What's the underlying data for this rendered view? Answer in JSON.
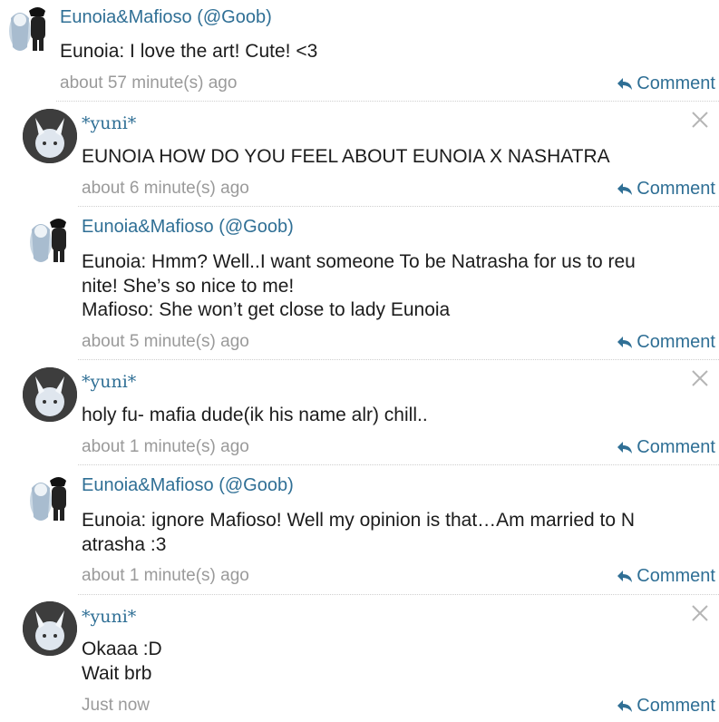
{
  "comments": [
    {
      "name": "Eunoia&Mafioso (@Goob)",
      "text": "Eunoia: I love the art! Cute! <3",
      "time": "about 57 minute(s) ago",
      "action": "Comment"
    },
    {
      "name": "*yuni*",
      "text": "EUNOIA HOW DO YOU FEEL ABOUT EUNOIA X NASHATRA",
      "time": "about 6 minute(s) ago",
      "action": "Comment"
    },
    {
      "name": "Eunoia&Mafioso (@Goob)",
      "text": "Eunoia: Hmm? Well..I want someone To be Natrasha for us to reu\nnite! She’s so nice to me!\nMafioso: She won’t get close to lady Eunoia",
      "time": "about 5 minute(s) ago",
      "action": "Comment"
    },
    {
      "name": "*yuni*",
      "text": "holy fu- mafia dude(ik his name alr) chill..",
      "time": "about 1 minute(s) ago",
      "action": "Comment"
    },
    {
      "name": "Eunoia&Mafioso (@Goob)",
      "text": "Eunoia: ignore Mafioso! Well my opinion is that…Am married to N\natrasha :3",
      "time": "about 1 minute(s) ago",
      "action": "Comment"
    },
    {
      "name": "*yuni*",
      "text": "Okaaa :D\nWait brb",
      "time": "Just now",
      "action": "Comment"
    }
  ],
  "colors": {
    "link": "#2f6f95",
    "timestamp": "#9a9a9a",
    "text": "#1c1c1c"
  },
  "icons": {
    "reply": "reply-arrow-icon",
    "close": "close-icon"
  }
}
